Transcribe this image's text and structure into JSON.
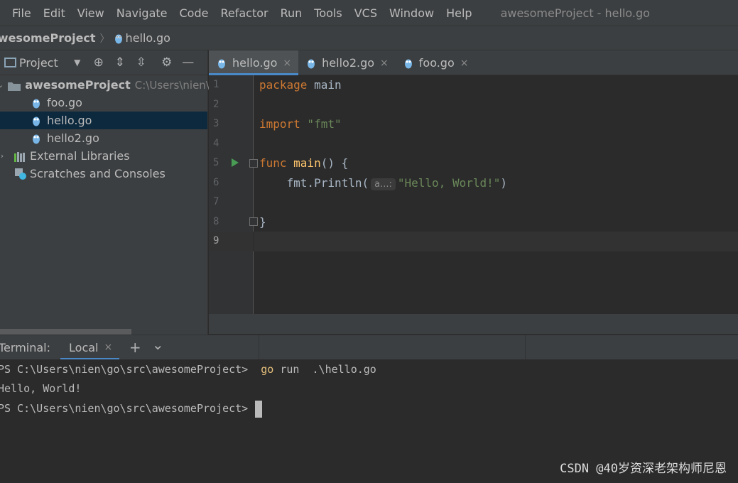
{
  "menu": [
    "File",
    "Edit",
    "View",
    "Navigate",
    "Code",
    "Refactor",
    "Run",
    "Tools",
    "VCS",
    "Window",
    "Help"
  ],
  "window_title": "awesomeProject - hello.go",
  "breadcrumb": {
    "project": "awesomeProject",
    "file": "hello.go"
  },
  "project_panel": {
    "title": "Project",
    "tree": {
      "root": {
        "label": "awesomeProject",
        "path_hint": "C:\\Users\\nien\\go"
      },
      "files": [
        "foo.go",
        "hello.go",
        "hello2.go"
      ],
      "external": "External Libraries",
      "scratches": "Scratches and Consoles"
    }
  },
  "editor": {
    "tabs": [
      {
        "label": "hello.go",
        "close": "×"
      },
      {
        "label": "hello2.go",
        "close": "×"
      },
      {
        "label": "foo.go",
        "close": "×"
      }
    ],
    "active_tab": "hello.go",
    "line_numbers": [
      "1",
      "2",
      "3",
      "4",
      "5",
      "6",
      "7",
      "8",
      "9"
    ],
    "code": {
      "l1_kw": "package",
      "l1_name": " main",
      "l3_kw": "import",
      "l3_str": " \"fmt\"",
      "l5_kw": "func",
      "l5_fn": " main",
      "l5_rest": "() {",
      "l6_pre": "    fmt.",
      "l6_fn": "Println",
      "l6_open": "(",
      "l6_hint": "a...:",
      "l6_str": "\"Hello, World!\"",
      "l6_close": ")",
      "l8": "}"
    }
  },
  "terminal": {
    "label": "Terminal:",
    "tab": "Local",
    "tab_close": "×",
    "add_button": "+",
    "menu_button": "⌄",
    "lines": {
      "prompt1": "PS C:\\Users\\nien\\go\\src\\awesomeProject>",
      "cmd": "  go",
      "args": " run  .\\hello.go",
      "output": "Hello, World!",
      "prompt2": "PS C:\\Users\\nien\\go\\src\\awesomeProject>"
    }
  },
  "watermark": "CSDN @40岁资深老架构师尼恩",
  "colors": {
    "keyword": "#cc7832",
    "function": "#ffc66d",
    "string": "#6a8759",
    "selection": "#0d293e",
    "tab_underline": "#4a88c7",
    "run_icon": "#499c54"
  }
}
